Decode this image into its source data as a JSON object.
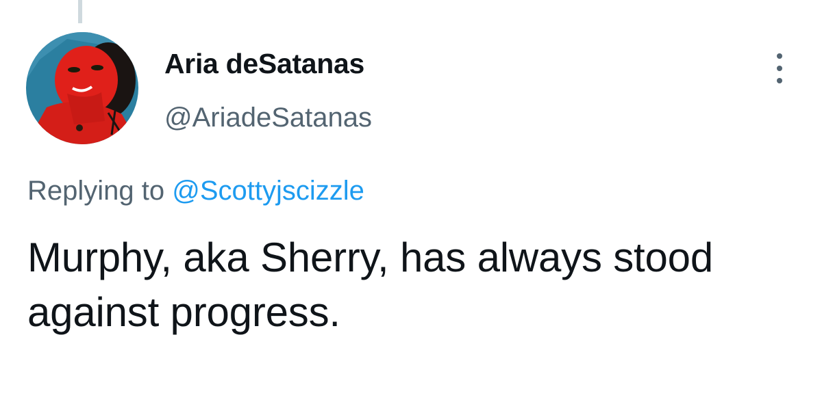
{
  "tweet": {
    "author": {
      "display_name": "Aria deSatanas",
      "handle": "@AriadeSatanas",
      "avatar_icon": "user-avatar"
    },
    "reply_prefix": "Replying to",
    "reply_handle": "@Scottyjscizzle",
    "text": "Murphy, aka Sherry, has always stood against progress.",
    "more_icon": "more-options-icon"
  },
  "colors": {
    "text_primary": "#0f1419",
    "text_secondary": "#536471",
    "link": "#1d9bf0",
    "thread_line": "#cfd9de"
  }
}
